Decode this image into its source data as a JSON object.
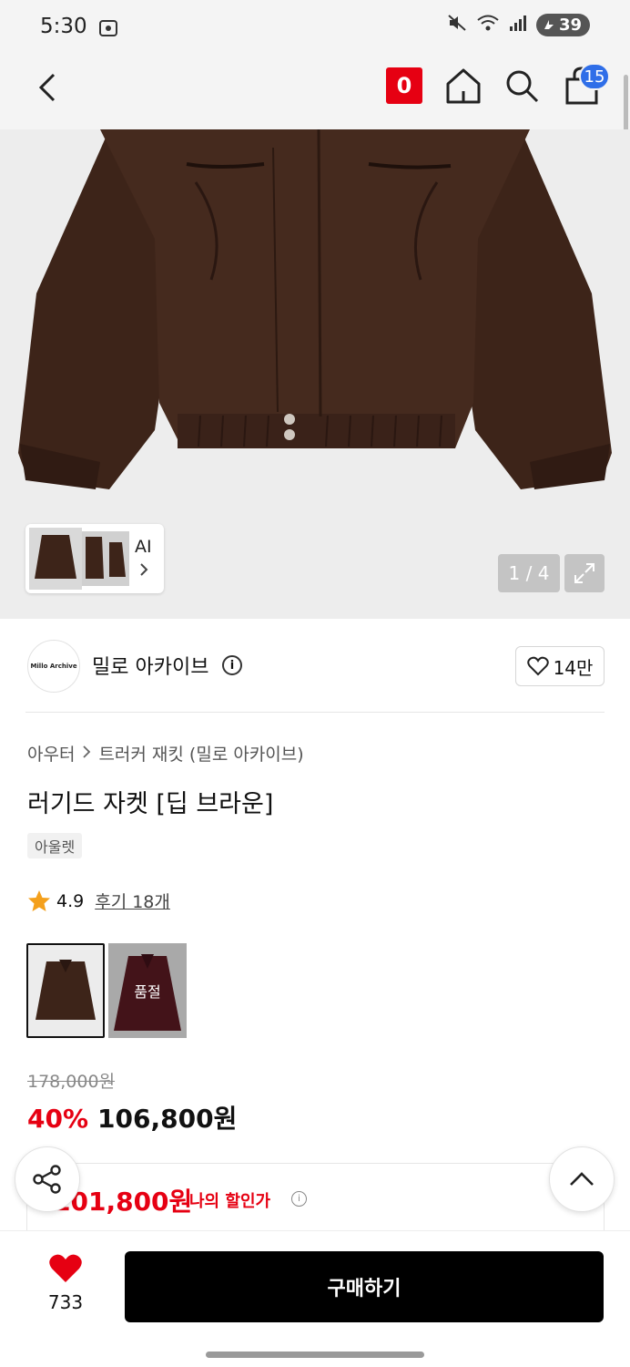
{
  "status": {
    "time": "5:30",
    "battery": "39"
  },
  "nav": {
    "zero_badge": "0",
    "cart_count": "15"
  },
  "hero": {
    "thumb_ai_label": "AI",
    "pager": "1 / 4"
  },
  "brand": {
    "logo_text": "Millo Archive",
    "name": "밀로 아카이브",
    "likes": "14만"
  },
  "product": {
    "breadcrumb": [
      "아우터",
      "트러커 재킷 (밀로 아카이브)"
    ],
    "title": "러기드 자켓 [딥 브라운]",
    "tag": "아울렛",
    "rating": "4.9",
    "reviews": "후기 18개",
    "swatches": [
      {
        "color": "#3a2118",
        "label": ""
      },
      {
        "color": "#5a1a22",
        "label": "품절"
      }
    ]
  },
  "price": {
    "original": "178,000원",
    "discount": "40%",
    "sale": "106,800원",
    "my_price": "101,800원",
    "my_price_label": "나의 할인가"
  },
  "bottom": {
    "wish_count": "733",
    "buy_label": "구매하기"
  },
  "colors": {
    "brand_red": "#e60012",
    "cart_blue": "#2f6ee8",
    "jacket_brown": "#3d2419"
  }
}
